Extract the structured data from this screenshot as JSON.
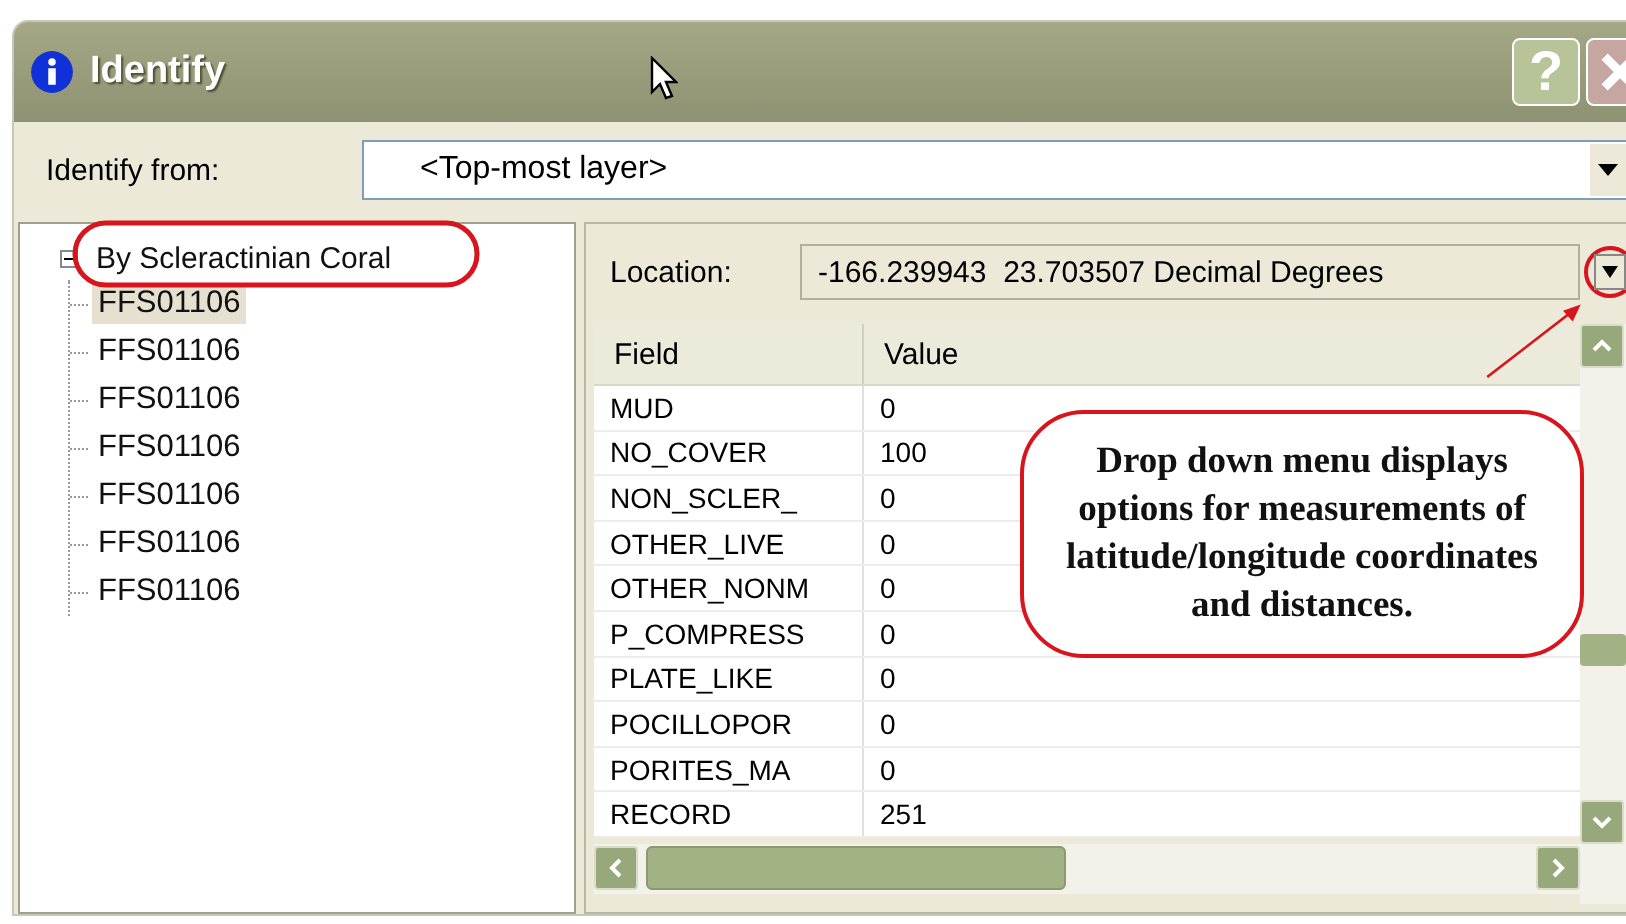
{
  "window": {
    "title": "Identify",
    "help_button": "?"
  },
  "identify_from": {
    "label": "Identify from:",
    "value": "<Top-most layer>"
  },
  "tree": {
    "root": {
      "label": "By Scleractinian Coral",
      "expanded": true,
      "children": [
        {
          "label": "FFS01106",
          "selected": true
        },
        {
          "label": "FFS01106",
          "selected": false
        },
        {
          "label": "FFS01106",
          "selected": false
        },
        {
          "label": "FFS01106",
          "selected": false
        },
        {
          "label": "FFS01106",
          "selected": false
        },
        {
          "label": "FFS01106",
          "selected": false
        },
        {
          "label": "FFS01106",
          "selected": false
        }
      ]
    }
  },
  "location": {
    "label": "Location:",
    "value": "-166.239943  23.703507 Decimal Degrees"
  },
  "table": {
    "columns": [
      "Field",
      "Value"
    ],
    "rows": [
      [
        "MUD",
        "0"
      ],
      [
        "NO_COVER",
        "100"
      ],
      [
        "NON_SCLER_",
        "0"
      ],
      [
        "OTHER_LIVE",
        "0"
      ],
      [
        "OTHER_NONM",
        "0"
      ],
      [
        "P_COMPRESS",
        "0"
      ],
      [
        "PLATE_LIKE",
        "0"
      ],
      [
        "POCILLOPOR",
        "0"
      ],
      [
        "PORITES_MA",
        "0"
      ],
      [
        "RECORD",
        "251"
      ]
    ]
  },
  "annotation": {
    "text": "Drop down menu displays options for measurements of latitude/longitude coordinates and distances."
  }
}
